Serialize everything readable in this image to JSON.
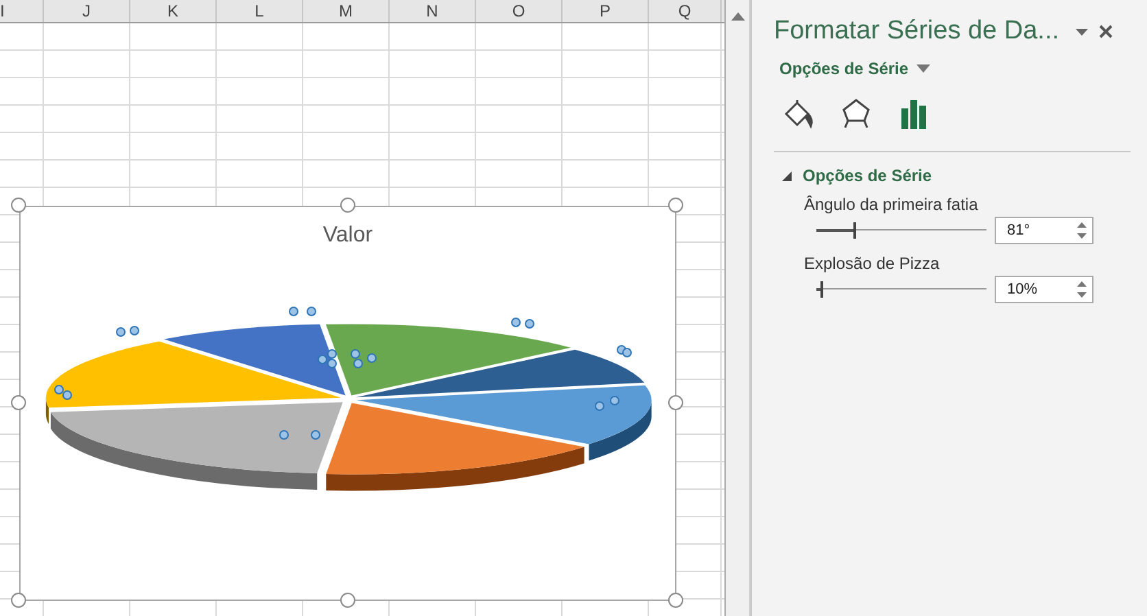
{
  "sheet": {
    "columns": [
      {
        "label": "I"
      },
      {
        "label": "J"
      },
      {
        "label": "K"
      },
      {
        "label": "L"
      },
      {
        "label": "M"
      },
      {
        "label": "N"
      },
      {
        "label": "O"
      },
      {
        "label": "P"
      },
      {
        "label": "Q"
      }
    ]
  },
  "chart": {
    "title": "Valor"
  },
  "panel": {
    "title": "Formatar Séries de Da...",
    "subtitle": "Opções de Série",
    "tabs": [
      {
        "kind": "fill",
        "selected": false
      },
      {
        "kind": "effects",
        "selected": false
      },
      {
        "kind": "options",
        "selected": true
      }
    ],
    "section": {
      "title": "Opções de Série",
      "expanded": true,
      "settings": [
        {
          "label": "Ângulo da primeira fatia",
          "level": 0.225,
          "value": "81°"
        },
        {
          "label": "Explosão de Pizza",
          "level": 0.03,
          "value": "10%"
        }
      ]
    }
  }
}
